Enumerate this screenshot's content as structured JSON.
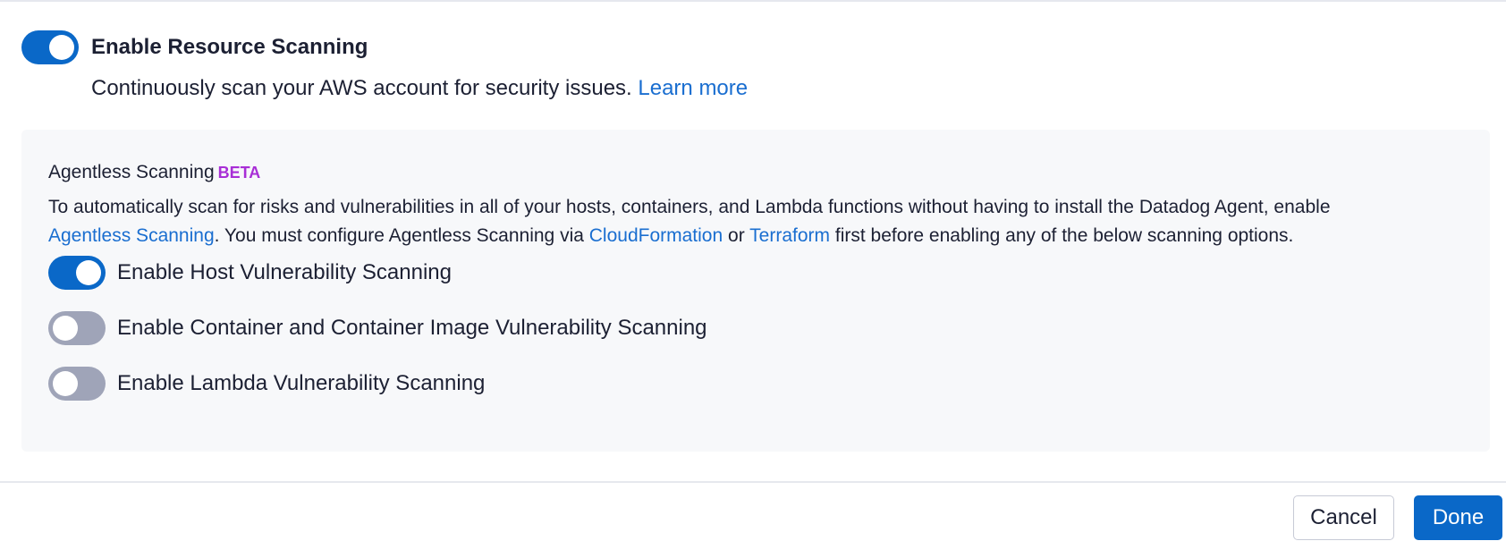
{
  "resource_scanning": {
    "title": "Enable Resource Scanning",
    "enabled": true,
    "description": "Continuously scan your AWS account for security issues.",
    "learn_more": "Learn more"
  },
  "agentless": {
    "title": "Agentless Scanning",
    "badge": "BETA",
    "desc_part1": "To automatically scan for risks and vulnerabilities in all of your hosts, containers, and Lambda functions without having to install the Datadog Agent, enable",
    "link_agentless": "Agentless Scanning",
    "desc_part2": ". You must configure Agentless Scanning via",
    "link_cloudformation": "CloudFormation",
    "desc_part3": "or",
    "link_terraform": "Terraform",
    "desc_part4": "first before enabling any of the below scanning options.",
    "options": [
      {
        "label": "Enable Host Vulnerability Scanning",
        "enabled": true
      },
      {
        "label": "Enable Container and Container Image Vulnerability Scanning",
        "enabled": false
      },
      {
        "label": "Enable Lambda Vulnerability Scanning",
        "enabled": false
      }
    ]
  },
  "footer": {
    "cancel_label": "Cancel",
    "done_label": "Done"
  },
  "colors": {
    "toggle_on": "#0a68c8",
    "toggle_off": "#9fa4b8",
    "link": "#1a6ed0",
    "beta": "#a82ed6"
  }
}
